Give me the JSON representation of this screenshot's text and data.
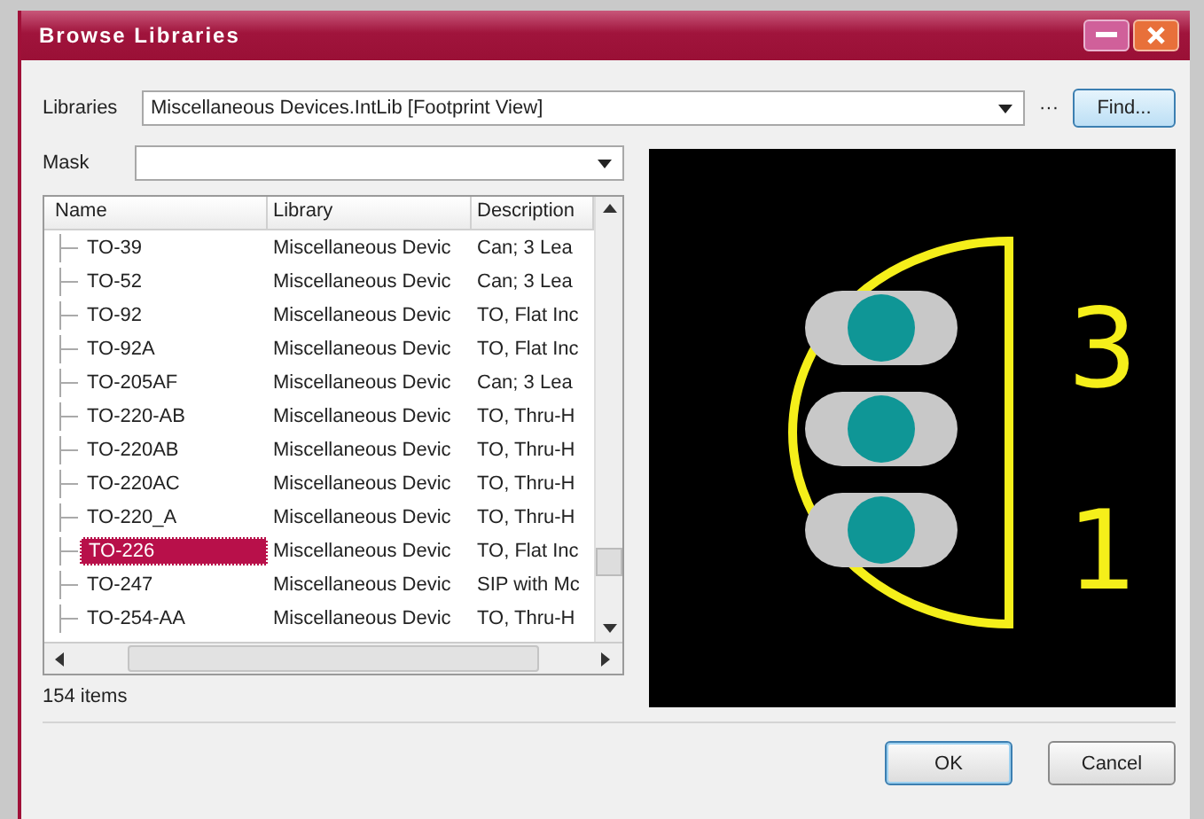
{
  "window": {
    "title": "Browse Libraries"
  },
  "libraries": {
    "label": "Libraries",
    "value": "Miscellaneous Devices.IntLib [Footprint View]",
    "more": "···",
    "find_button": "Find..."
  },
  "mask": {
    "label": "Mask"
  },
  "table": {
    "columns": [
      "Name",
      "Library",
      "Description"
    ],
    "rows": [
      {
        "name": "TO-39",
        "library": "Miscellaneous Devic",
        "description": "Can; 3 Lea",
        "selected": false
      },
      {
        "name": "TO-52",
        "library": "Miscellaneous Devic",
        "description": "Can; 3 Lea",
        "selected": false
      },
      {
        "name": "TO-92",
        "library": "Miscellaneous Devic",
        "description": "TO, Flat Inc",
        "selected": false
      },
      {
        "name": "TO-92A",
        "library": "Miscellaneous Devic",
        "description": "TO, Flat Inc",
        "selected": false
      },
      {
        "name": "TO-205AF",
        "library": "Miscellaneous Devic",
        "description": "Can; 3 Lea",
        "selected": false
      },
      {
        "name": "TO-220-AB",
        "library": "Miscellaneous Devic",
        "description": "TO, Thru-H",
        "selected": false
      },
      {
        "name": "TO-220AB",
        "library": "Miscellaneous Devic",
        "description": "TO, Thru-H",
        "selected": false
      },
      {
        "name": "TO-220AC",
        "library": "Miscellaneous Devic",
        "description": "TO, Thru-H",
        "selected": false
      },
      {
        "name": "TO-220_A",
        "library": "Miscellaneous Devic",
        "description": "TO, Thru-H",
        "selected": false
      },
      {
        "name": "TO-226",
        "library": "Miscellaneous Devic",
        "description": "TO, Flat Inc",
        "selected": true
      },
      {
        "name": "TO-247",
        "library": "Miscellaneous Devic",
        "description": "SIP with Mc",
        "selected": false
      },
      {
        "name": "TO-254-AA",
        "library": "Miscellaneous Devic",
        "description": "TO, Thru-H",
        "selected": false
      }
    ]
  },
  "status": "154 items",
  "preview": {
    "pin_labels": [
      "3",
      "1"
    ]
  },
  "buttons": [
    "OK",
    "Cancel"
  ]
}
